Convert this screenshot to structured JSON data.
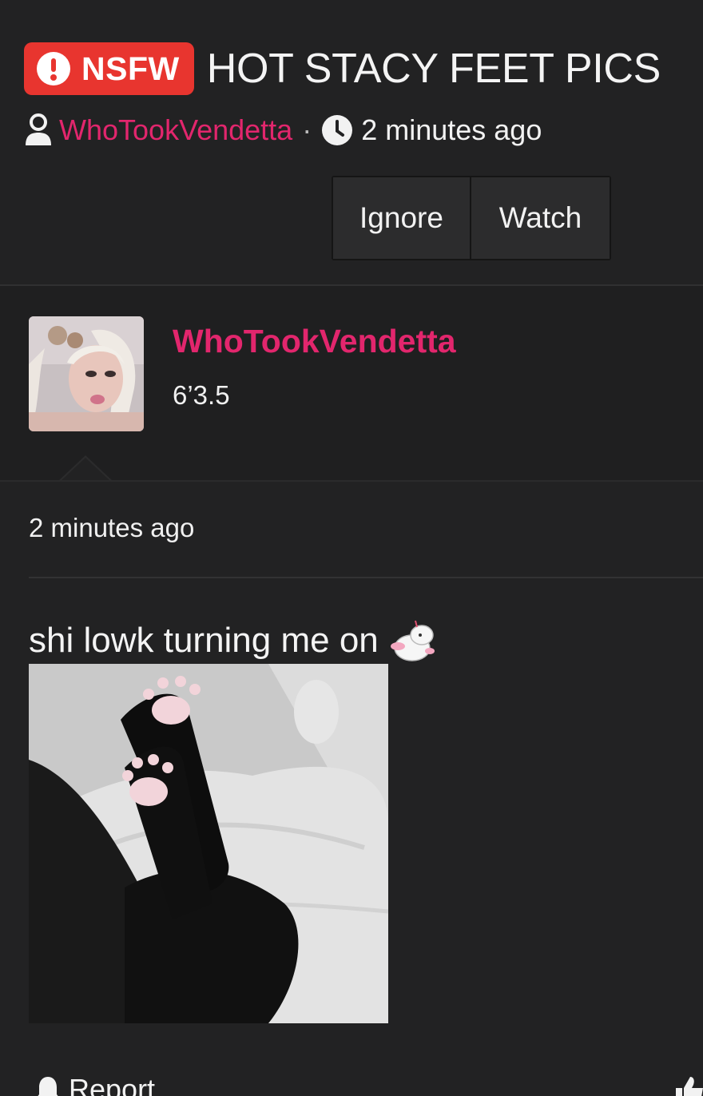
{
  "thread": {
    "badge_label": "NSFW",
    "title": "HOT STACY FEET PICS",
    "author": "WhoTookVendetta",
    "separator": "·",
    "time": "2 minutes ago"
  },
  "actions": {
    "ignore_label": "Ignore",
    "watch_label": "Watch"
  },
  "post": {
    "username": "WhoTookVendetta",
    "user_title": "6’3.5",
    "time": "2 minutes ago",
    "text": "shi lowk turning me on",
    "report_label": "Report"
  },
  "colors": {
    "background": "#222223",
    "accent_pink": "#e2266d",
    "nsfw_red": "#e8352f"
  },
  "icons": [
    "alert-icon",
    "user-icon",
    "clock-icon",
    "bell-icon",
    "thumbs-up-icon"
  ]
}
